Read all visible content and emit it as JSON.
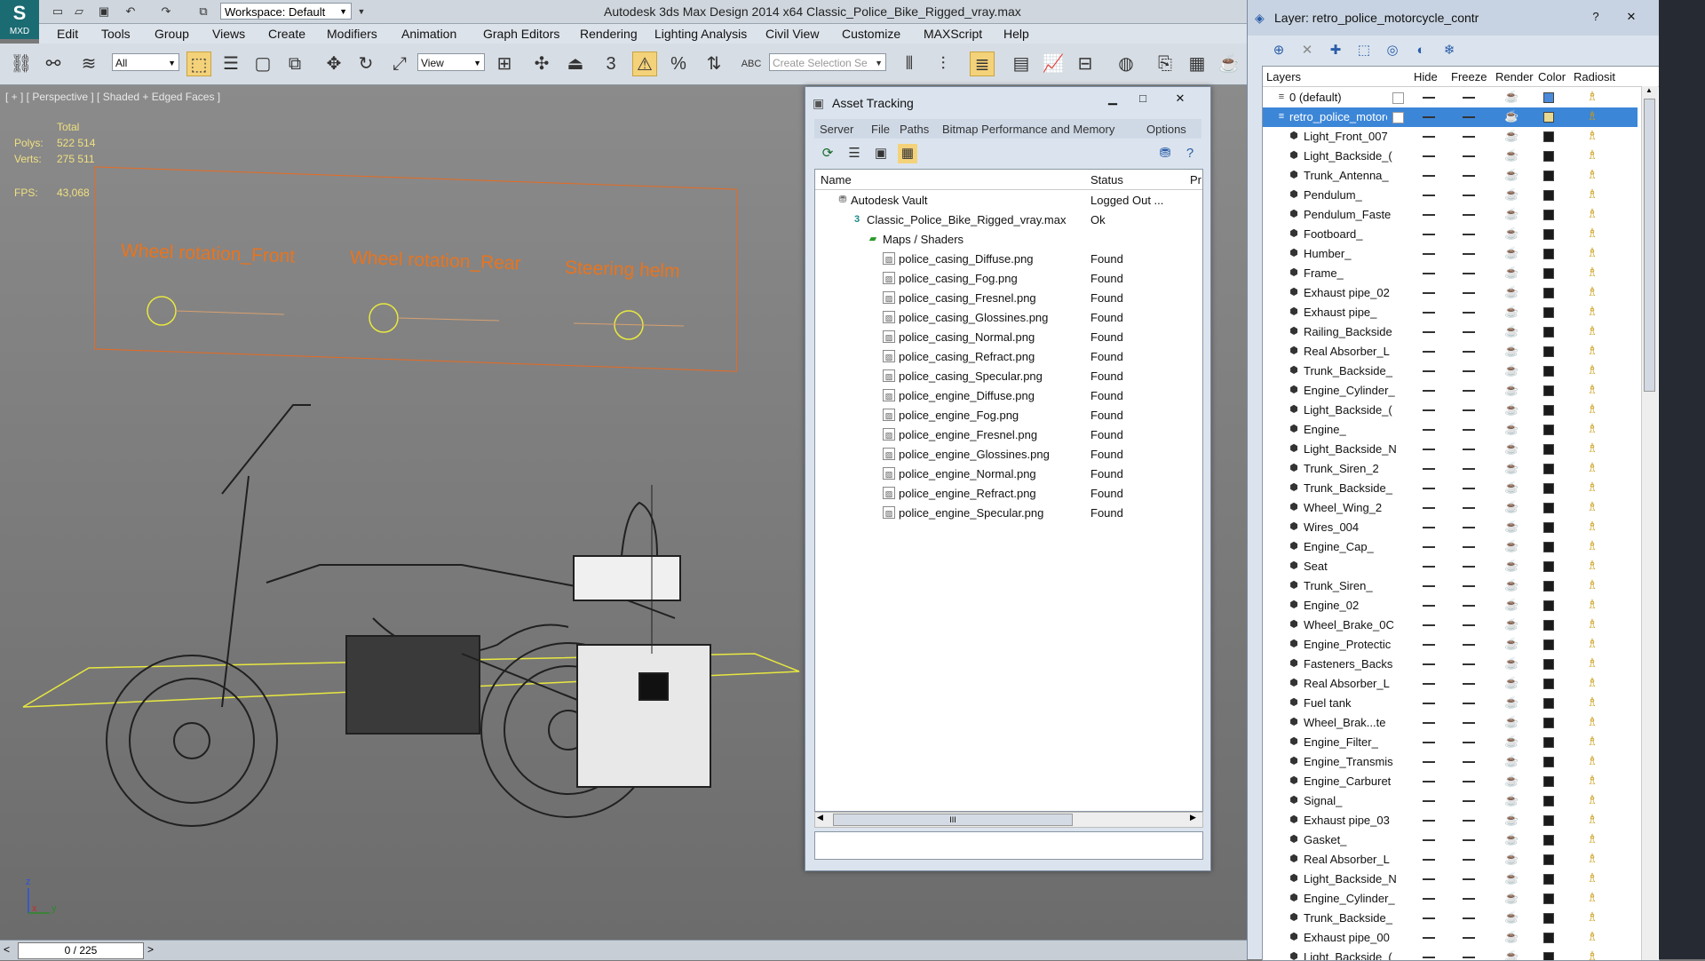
{
  "window": {
    "app_title": "Autodesk 3ds Max Design 2014 x64      Classic_Police_Bike_Rigged_vray.max",
    "logo_text": "MXD",
    "workspace": "Workspace: Default"
  },
  "menu": [
    "Edit",
    "Tools",
    "Group",
    "Views",
    "Create",
    "Modifiers",
    "Animation",
    "Graph Editors",
    "Rendering",
    "Lighting Analysis",
    "Civil View",
    "Customize",
    "MAXScript",
    "Help"
  ],
  "toolbar": {
    "selection_filter": "All",
    "reference_coord": "View",
    "selection_set_placeholder": "Create Selection Se",
    "snap_3": "3",
    "snap_angle": "%",
    "text_abc": "ABC"
  },
  "viewport": {
    "label": "[ + ] [ Perspective ] [ Shaded + Edged Faces ]",
    "stats": {
      "total_label": "Total",
      "polys_label": "Polys:",
      "polys": "522 514",
      "verts_label": "Verts:",
      "verts": "275 511",
      "fps_label": "FPS:",
      "fps": "43,068"
    },
    "rig_labels": [
      "Wheel rotation_Front",
      "Wheel rotation_Rear",
      "Steering helm"
    ],
    "axis_z": "z",
    "axis_x": "x",
    "axis_y": "y",
    "timeline": "0 / 225"
  },
  "asset_tracking": {
    "title": "Asset Tracking",
    "menu": [
      "Server",
      "File",
      "Paths",
      "Bitmap Performance and Memory",
      "Options"
    ],
    "columns": {
      "name": "Name",
      "status": "Status",
      "path": "Pr"
    },
    "vault": {
      "name": "Autodesk Vault",
      "status": "Logged Out ..."
    },
    "file": {
      "name": "Classic_Police_Bike_Rigged_vray.max",
      "status": "Ok"
    },
    "maps_group": "Maps / Shaders",
    "maps": [
      {
        "name": "police_casing_Diffuse.png",
        "status": "Found"
      },
      {
        "name": "police_casing_Fog.png",
        "status": "Found"
      },
      {
        "name": "police_casing_Fresnel.png",
        "status": "Found"
      },
      {
        "name": "police_casing_Glossines.png",
        "status": "Found"
      },
      {
        "name": "police_casing_Normal.png",
        "status": "Found"
      },
      {
        "name": "police_casing_Refract.png",
        "status": "Found"
      },
      {
        "name": "police_casing_Specular.png",
        "status": "Found"
      },
      {
        "name": "police_engine_Diffuse.png",
        "status": "Found"
      },
      {
        "name": "police_engine_Fog.png",
        "status": "Found"
      },
      {
        "name": "police_engine_Fresnel.png",
        "status": "Found"
      },
      {
        "name": "police_engine_Glossines.png",
        "status": "Found"
      },
      {
        "name": "police_engine_Normal.png",
        "status": "Found"
      },
      {
        "name": "police_engine_Refract.png",
        "status": "Found"
      },
      {
        "name": "police_engine_Specular.png",
        "status": "Found"
      }
    ],
    "scroll_grip": "III"
  },
  "layer_panel": {
    "title": "Layer: retro_police_motorcycle_contr",
    "columns": {
      "layers": "Layers",
      "hide": "Hide",
      "freeze": "Freeze",
      "render": "Render",
      "color": "Color",
      "radiosity": "Radiosit"
    },
    "default_layer": "0 (default)",
    "selected_layer": "retro_police_motorc",
    "objects": [
      "Light_Front_007",
      "Light_Backside_(",
      "Trunk_Antenna_",
      "Pendulum_",
      "Pendulum_Faste",
      "Footboard_",
      "Humber_",
      "Frame_",
      "Exhaust pipe_02",
      "Exhaust pipe_",
      "Railing_Backside",
      "Real Absorber_L",
      "Trunk_Backside_",
      "Engine_Cylinder_",
      "Light_Backside_(",
      "Engine_",
      "Light_Backside_N",
      "Trunk_Siren_2",
      "Trunk_Backside_",
      "Wheel_Wing_2",
      "Wires_004",
      "Engine_Cap_",
      "Seat",
      "Trunk_Siren_",
      "Engine_02",
      "Wheel_Brake_0C",
      "Engine_Protectic",
      "Fasteners_Backs",
      "Real Absorber_L",
      "Fuel tank",
      "Wheel_Brak...te",
      "Engine_Filter_",
      "Engine_Transmis",
      "Engine_Carburet",
      "Signal_",
      "Exhaust pipe_03",
      "Gasket_",
      "Real Absorber_L",
      "Light_Backside_N",
      "Engine_Cylinder_",
      "Trunk_Backside_",
      "Exhaust pipe_00",
      "Light_Backside_("
    ],
    "colors": {
      "object": "#1a1a1a",
      "default": "#4a8ad8",
      "selected": "#e8d890"
    }
  },
  "colors": {
    "accent_orange": "#e8741e",
    "stats_yellow": "#f0e080",
    "rig_circle": "#e8e840",
    "selection_blue": "#3c86d8"
  }
}
